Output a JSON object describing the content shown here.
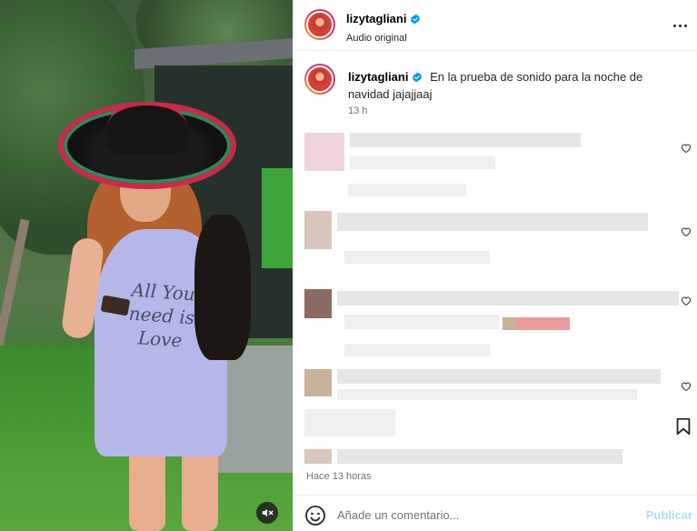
{
  "media": {
    "shirt_text": "All You need is Love",
    "mute_icon": "speaker-muted-icon"
  },
  "header": {
    "username": "lizytagliani",
    "subtitle": "Audio original",
    "verified_icon": "verified-badge-icon",
    "more_icon": "more-options-icon"
  },
  "caption": {
    "username": "lizytagliani",
    "text": "En la prueba de sonido para la noche de navidad jajajjaaj",
    "time": "13 h"
  },
  "footer": {
    "timestamp": "Hace 13 horas",
    "comment_placeholder": "Añade un comentario...",
    "publish_label": "Publicar",
    "emoji_icon": "emoji-icon",
    "bookmark_icon": "bookmark-icon",
    "heart_icon": "heart-icon"
  },
  "colors": {
    "accent": "#0095f6",
    "publish_disabled": "#b3dbff",
    "muted_text": "#737373",
    "verified_blue": "#0095f6"
  }
}
